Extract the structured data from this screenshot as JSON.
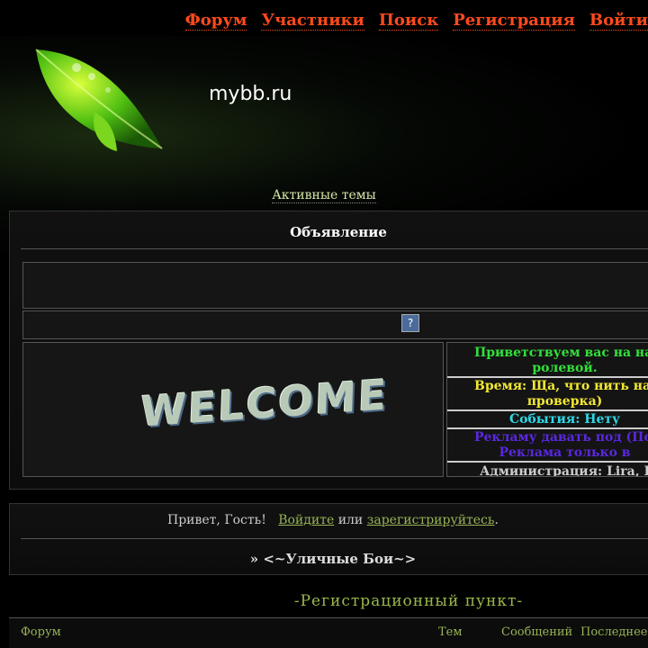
{
  "nav": {
    "forum": "Форум",
    "members": "Участники",
    "search": "Поиск",
    "register": "Регистрация",
    "login": "Войти"
  },
  "logo": {
    "text": "mybb.ru"
  },
  "active_topics": "Активные темы",
  "announcement": {
    "title": "Объявление",
    "help_icon": "?",
    "welcome_text": "WELCOME",
    "lines": [
      {
        "text": "Приветствуем вас на нап",
        "text2": "ролевой.",
        "color": "#33e03a"
      },
      {
        "text": "Время: Ща, что нить напишу",
        "text2": "проверка)",
        "color": "#f2e833"
      },
      {
        "text": "События: Нету",
        "color": "#2fd8e8"
      },
      {
        "text": "Рекламу давать под (Пока",
        "text2": "Реклама только в",
        "color": "#5a28e0"
      },
      {
        "text": "Администрация: Lira, I",
        "color": "#cccccc"
      }
    ]
  },
  "greeting": {
    "prefix": "Привет, Гость!",
    "login_link": "Войдите",
    "or": "или",
    "register_link": "зарегистрируйтесь",
    "suffix": ".",
    "forum_name": "» <~Уличные Бои~>"
  },
  "section_title": "-Регистрационный пункт-",
  "table_headers": {
    "forum": "Форум",
    "topics": "Тем",
    "posts": "Сообщений",
    "last": "Последнее"
  },
  "colors": {
    "nav": "#ff4a1c",
    "link": "#97b354",
    "section": "#9ab84a"
  }
}
